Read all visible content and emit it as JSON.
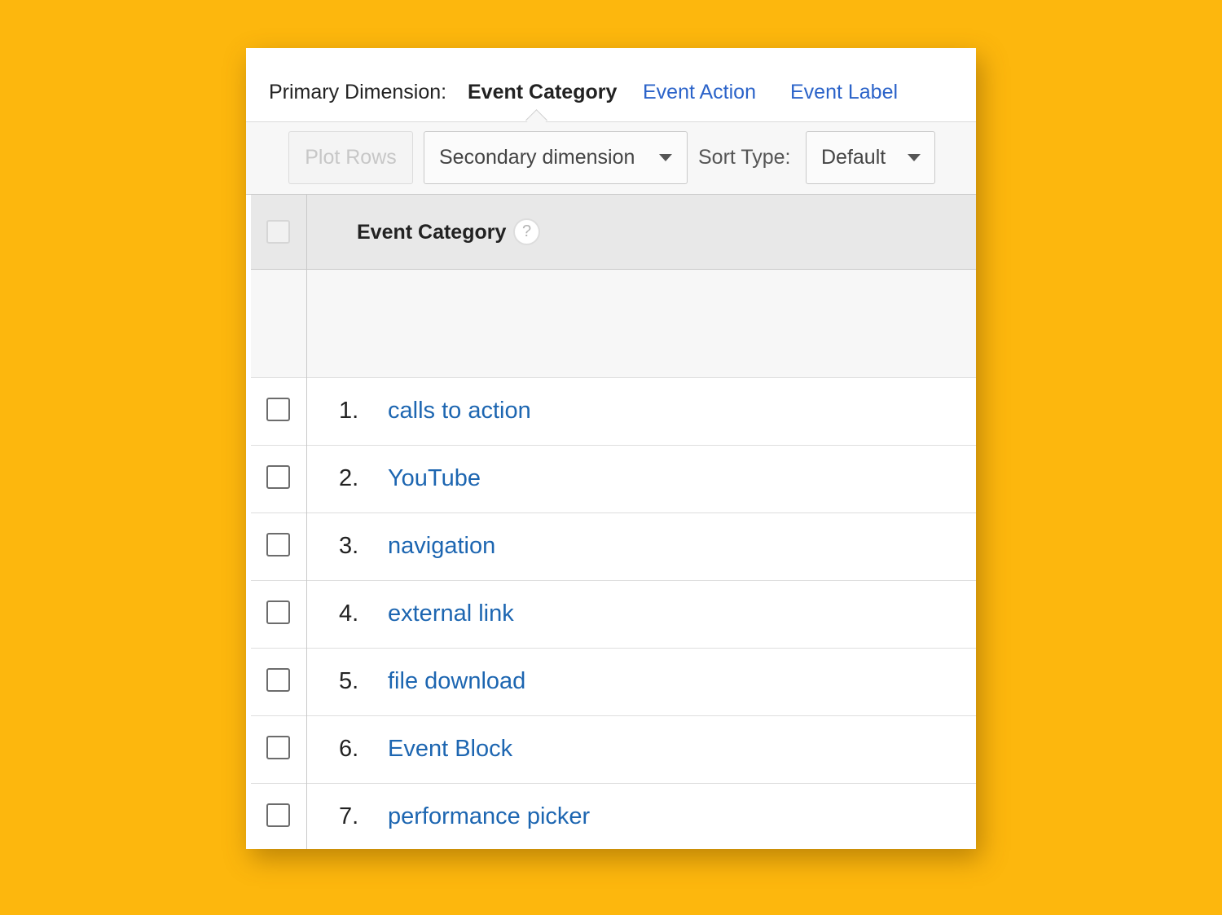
{
  "primary_dimension": {
    "label": "Primary Dimension:",
    "active": "Event Category",
    "links": [
      "Event Action",
      "Event Label"
    ]
  },
  "toolbar": {
    "plot_rows_label": "Plot Rows",
    "secondary_dimension_label": "Secondary dimension",
    "sort_type_label": "Sort Type:",
    "sort_type_value": "Default"
  },
  "table": {
    "column_header": "Event Category",
    "help_icon": "?",
    "rows": [
      {
        "num": "1.",
        "label": "calls to action"
      },
      {
        "num": "2.",
        "label": "YouTube"
      },
      {
        "num": "3.",
        "label": "navigation"
      },
      {
        "num": "4.",
        "label": "external link"
      },
      {
        "num": "5.",
        "label": "file download"
      },
      {
        "num": "6.",
        "label": "Event Block"
      },
      {
        "num": "7.",
        "label": "performance picker"
      }
    ]
  },
  "colors": {
    "background": "#FDB70D",
    "link": "#1d66b1",
    "tab_link": "#2b63c9"
  }
}
